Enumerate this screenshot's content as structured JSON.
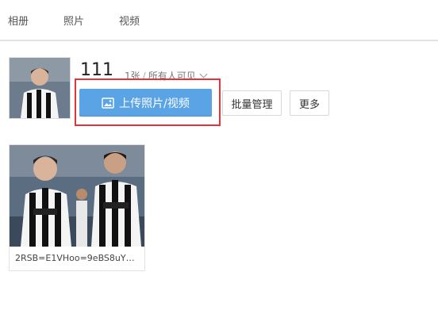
{
  "tabs": [
    {
      "label": "相册"
    },
    {
      "label": "照片"
    },
    {
      "label": "视频"
    }
  ],
  "album": {
    "title": "111",
    "count": "1张",
    "separator": "/",
    "visibility": "所有人可见",
    "cover_icon": "athlete-photo-icon"
  },
  "toolbar": {
    "upload_label": "上传照片/视频",
    "upload_icon": "image-upload-icon",
    "batch_label": "批量管理",
    "more_label": "更多",
    "upload_color": "#5aa4e5",
    "highlight_color": "#e2343b"
  },
  "photos": [
    {
      "name": "2RSB=E1VHoo=9eBS8uY…"
    }
  ]
}
